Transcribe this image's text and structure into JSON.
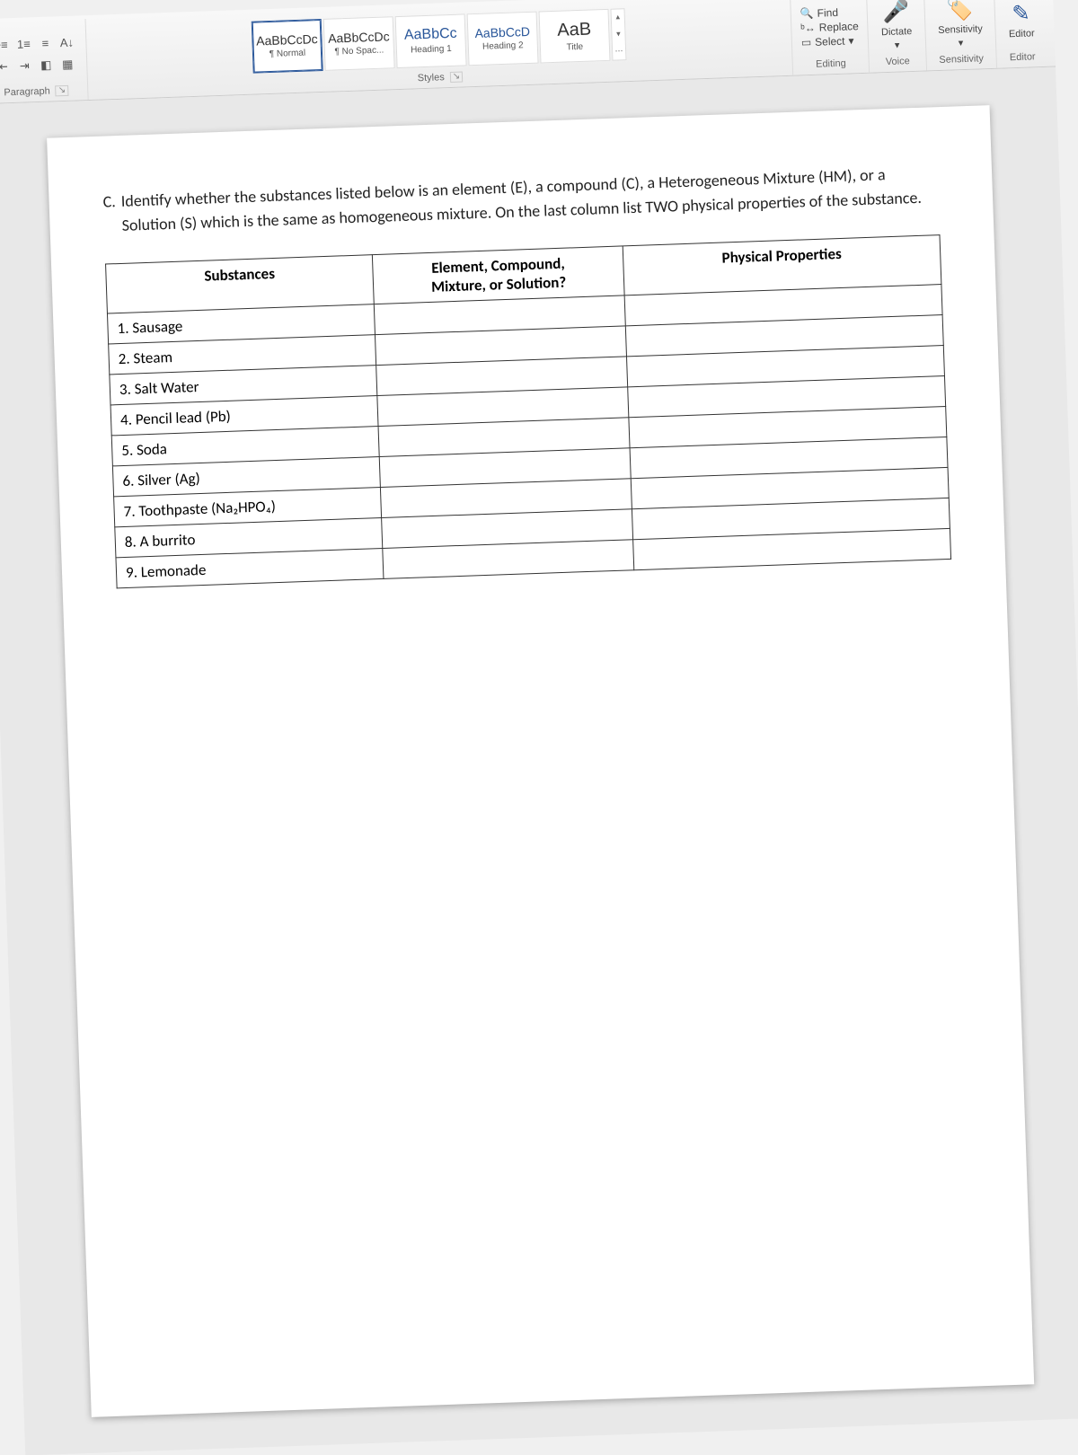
{
  "ribbon": {
    "paragraph": {
      "label": "Paragraph"
    },
    "styles": {
      "label": "Styles",
      "items": [
        {
          "sample": "AaBbCcDc",
          "label": "¶ Normal",
          "cls": ""
        },
        {
          "sample": "AaBbCcDc",
          "label": "¶ No Spac...",
          "cls": ""
        },
        {
          "sample": "AaBbCc",
          "label": "Heading 1",
          "cls": "h1"
        },
        {
          "sample": "AaBbCcD",
          "label": "Heading 2",
          "cls": "blue"
        },
        {
          "sample": "AaB",
          "label": "Title",
          "cls": "title"
        }
      ]
    },
    "editing": {
      "label": "Editing",
      "find": "Find",
      "replace": "Replace",
      "select": "Select"
    },
    "voice": {
      "label": "Voice",
      "dictate": "Dictate"
    },
    "sensitivity": {
      "label": "Sensitivity",
      "btn": "Sensitivity"
    },
    "editor": {
      "label": "Editor",
      "btn": "Editor"
    }
  },
  "document": {
    "question_letter": "C.",
    "question_text": "Identify whether the substances listed below is an element (E), a compound (C), a Heterogeneous Mixture (HM), or a Solution (S) which is the same as homogeneous mixture. On the last column list TWO physical properties of the substance.",
    "headers": {
      "substances": "Substances",
      "type_line1": "Element, Compound,",
      "type_line2": "Mixture, or Solution?",
      "properties": "Physical Properties"
    },
    "rows": [
      "1. Sausage",
      "2. Steam",
      "3. Salt Water",
      "4. Pencil lead (Pb)",
      "5. Soda",
      "6. Silver (Ag)",
      "7. Toothpaste (Na₂HPO₄)",
      "8. A burrito",
      "9. Lemonade"
    ]
  }
}
